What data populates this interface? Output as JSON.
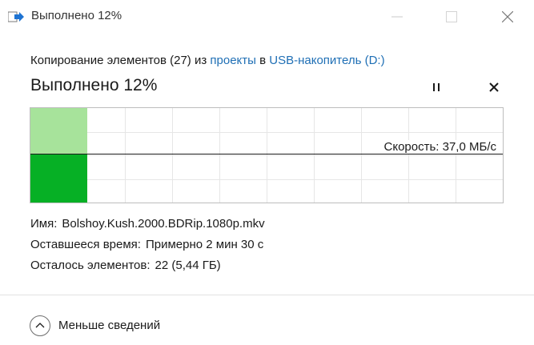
{
  "window": {
    "title": "Выполнено 12%",
    "icon": "file-copy-icon",
    "controls": [
      "minimize-icon",
      "maximize-icon",
      "close-icon"
    ]
  },
  "copy_description": {
    "prefix": "Копирование элементов (27) из",
    "source": "проекты",
    "connector": "в",
    "destination": "USB-накопитель (D:)"
  },
  "status": {
    "text": "Выполнено 12%",
    "progress_percent": 12,
    "pause_icon": "pause-icon",
    "cancel_icon": "close-icon"
  },
  "graph": {
    "speed_label": "Скорость: 37,0 МБ/с",
    "completed_fraction": 0.12,
    "current_speed_level": 0.52,
    "colors": {
      "completed": "#06b025",
      "completed_light": "#a7e39b",
      "grid": "#e6e6e6",
      "line": "#1a1a1a"
    }
  },
  "details": {
    "name_label": "Имя:",
    "name_value": "Bolshoy.Kush.2000.BDRip.1080p.mkv",
    "time_label": "Оставшееся время:",
    "time_value": "Примерно 2 мин 30 с",
    "items_label": "Осталось элементов:",
    "items_value": "22 (5,44 ГБ)"
  },
  "footer": {
    "toggle_label": "Меньше сведений",
    "toggle_icon": "chevron-up-icon"
  },
  "colors": {
    "link": "#1f6fb5",
    "accent_green": "#06b025"
  }
}
